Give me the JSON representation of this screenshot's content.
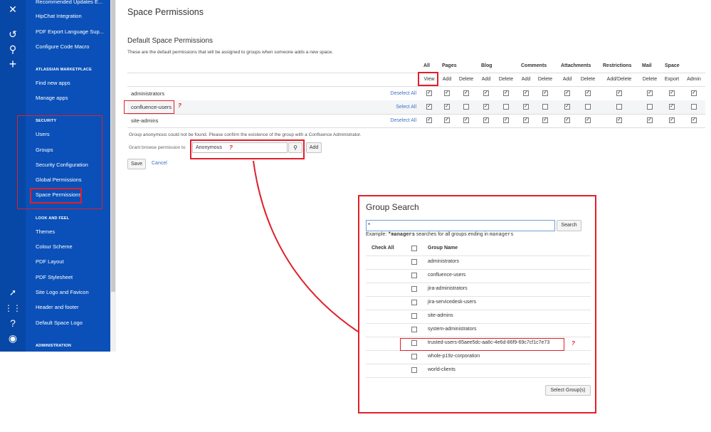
{
  "sidebar": {
    "items_top": [
      "Recommended Updates E...",
      "HipChat Integration",
      "PDF Export Language Sup...",
      "Configure Code Macro"
    ],
    "marketplace_heading": "ATLASSIAN MARKETPLACE",
    "marketplace_items": [
      "Find new apps",
      "Manage apps"
    ],
    "security_heading": "SECURITY",
    "security_items": [
      "Users",
      "Groups",
      "Security Configuration",
      "Global Permissions",
      "Space Permissions"
    ],
    "look_heading": "LOOK AND FEEL",
    "look_items": [
      "Themes",
      "Colour Scheme",
      "PDF Layout",
      "PDF Stylesheet",
      "Site Logo and Favicon",
      "Header and footer",
      "Default Space Logo"
    ],
    "admin_heading": "ADMINISTRATION"
  },
  "page": {
    "title": "Space Permissions",
    "subtitle": "Default Space Permissions",
    "description": "These are the default permissions that will be assigned to groups when someone adds a new space."
  },
  "table": {
    "groups": [
      "All",
      "Pages",
      "Blog",
      "Comments",
      "Attachments",
      "Restrictions",
      "Mail",
      "Space"
    ],
    "subheaders": [
      "View",
      "Add",
      "Delete",
      "Add",
      "Delete",
      "Add",
      "Delete",
      "Add",
      "Delete",
      "Add/Delete",
      "Delete",
      "Export",
      "Admin"
    ],
    "rows": [
      {
        "name": "administrators",
        "action": "Deselect All",
        "checks": [
          true,
          true,
          true,
          true,
          true,
          true,
          true,
          true,
          true,
          true,
          true,
          true,
          true
        ]
      },
      {
        "name": "confluence-users",
        "action": "Select All",
        "checks": [
          true,
          true,
          false,
          true,
          false,
          true,
          false,
          true,
          false,
          false,
          false,
          true,
          false
        ]
      },
      {
        "name": "site-admins",
        "action": "Deselect All",
        "checks": [
          true,
          true,
          true,
          true,
          true,
          true,
          true,
          true,
          true,
          true,
          true,
          true,
          true
        ]
      }
    ]
  },
  "note": "Group anonymous could not be found. Please confirm the existence of the group with a Confluence Administrator.",
  "grant": {
    "label": "Grant browse permission to",
    "value": "Anonymous",
    "add_label": "Add"
  },
  "actions": {
    "save_label": "Save",
    "cancel_label": "Cancel"
  },
  "dialog": {
    "title": "Group Search",
    "search_value": "*",
    "search_label": "Search",
    "example_prefix": "Example: ",
    "example_code": "*managers",
    "example_mid": " searches for all groups ending in ",
    "example_code2": "managers",
    "check_all_label": "Check All",
    "group_name_label": "Group Name",
    "groups": [
      "administrators",
      "confluence-users",
      "jira-administrators",
      "jira-servicedesk-users",
      "site-admins",
      "system-administrators",
      "trusted-users-85aee5dc-aa8c-4e6d-86f9-69c7cf1c7e73",
      "whole-p19z-corporation",
      "world-clients"
    ],
    "select_label": "Select Group(s)"
  },
  "annotation": {
    "mark": "?"
  },
  "colors": {
    "sidebar": "#0a50b8",
    "iconbar": "#0747a6",
    "highlight": "#e0202a",
    "link": "#3b73c4"
  }
}
